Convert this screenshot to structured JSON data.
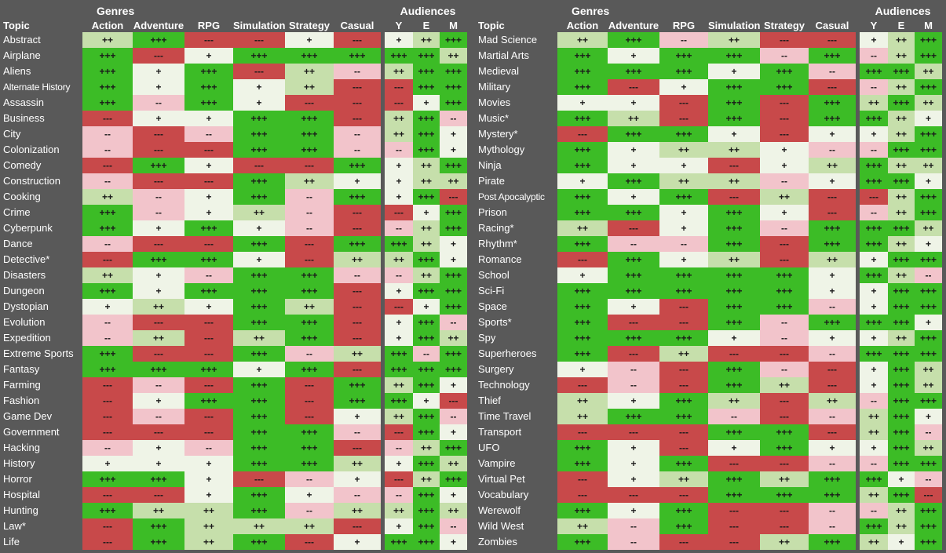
{
  "header": {
    "group_genres": "Genres",
    "group_audiences": "Audiences",
    "topic_label": "Topic",
    "genre_columns": [
      "Action",
      "Adventure",
      "RPG",
      "Simulation",
      "Strategy",
      "Casual"
    ],
    "audience_columns": [
      "Y",
      "E",
      "M"
    ]
  },
  "legend": {
    "values": [
      "+++",
      "++",
      "+",
      "--",
      "---"
    ],
    "colors": {
      "+++": "#3cbc26",
      "++": "#c6dfab",
      "+": "#eff4e7",
      "--": "#f2c4cb",
      "---": "#c8494a",
      "background": "#595959",
      "text": "#ffffff"
    }
  },
  "chart_data": {
    "type": "heatmap",
    "title": "",
    "xlabel": "",
    "ylabel": "Topic",
    "columns": [
      "Action",
      "Adventure",
      "RPG",
      "Simulation",
      "Strategy",
      "Casual",
      "Y",
      "E",
      "M"
    ],
    "column_groups": [
      {
        "name": "Genres",
        "columns": [
          "Action",
          "Adventure",
          "RPG",
          "Simulation",
          "Strategy",
          "Casual"
        ]
      },
      {
        "name": "Audiences",
        "columns": [
          "Y",
          "E",
          "M"
        ]
      }
    ],
    "scale": [
      "---",
      "--",
      "+",
      "++",
      "+++"
    ],
    "left_rows": [
      {
        "topic": "Abstract",
        "values": [
          "++",
          "+++",
          "---",
          "---",
          "+",
          "---",
          "+",
          "++",
          "+++"
        ]
      },
      {
        "topic": "Airplane",
        "values": [
          "+++",
          "---",
          "+",
          "+++",
          "+++",
          "+++",
          "+++",
          "+++",
          "++"
        ]
      },
      {
        "topic": "Aliens",
        "values": [
          "+++",
          "+",
          "+++",
          "---",
          "++",
          "--",
          "++",
          "+++",
          "+++"
        ]
      },
      {
        "topic": "Alternate History",
        "values": [
          "+++",
          "+",
          "+++",
          "+",
          "++",
          "---",
          "---",
          "+++",
          "+++"
        ]
      },
      {
        "topic": "Assassin",
        "values": [
          "+++",
          "--",
          "+++",
          "+",
          "---",
          "---",
          "---",
          "+",
          "+++"
        ]
      },
      {
        "topic": "Business",
        "values": [
          "---",
          "+",
          "+",
          "+++",
          "+++",
          "---",
          "++",
          "+++",
          "--"
        ]
      },
      {
        "topic": "City",
        "values": [
          "--",
          "---",
          "--",
          "+++",
          "+++",
          "--",
          "++",
          "+++",
          "+"
        ]
      },
      {
        "topic": "Colonization",
        "values": [
          "--",
          "---",
          "---",
          "+++",
          "+++",
          "--",
          "--",
          "+++",
          "+"
        ]
      },
      {
        "topic": "Comedy",
        "values": [
          "---",
          "+++",
          "+",
          "---",
          "---",
          "+++",
          "+",
          "++",
          "+++"
        ]
      },
      {
        "topic": "Construction",
        "values": [
          "--",
          "---",
          "---",
          "+++",
          "++",
          "+",
          "+",
          "++",
          "++"
        ]
      },
      {
        "topic": "Cooking",
        "values": [
          "++",
          "--",
          "+",
          "+++",
          "--",
          "+++",
          "+",
          "+++",
          "---"
        ]
      },
      {
        "topic": "Crime",
        "values": [
          "+++",
          "--",
          "+",
          "++",
          "--",
          "---",
          "---",
          "+",
          "+++"
        ]
      },
      {
        "topic": "Cyberpunk",
        "values": [
          "+++",
          "+",
          "+++",
          "+",
          "--",
          "---",
          "--",
          "++",
          "+++"
        ]
      },
      {
        "topic": "Dance",
        "values": [
          "--",
          "---",
          "---",
          "+++",
          "---",
          "+++",
          "+++",
          "++",
          "+"
        ]
      },
      {
        "topic": "Detective*",
        "values": [
          "---",
          "+++",
          "+++",
          "+",
          "---",
          "++",
          "++",
          "+++",
          "+"
        ]
      },
      {
        "topic": "Disasters",
        "values": [
          "++",
          "+",
          "--",
          "+++",
          "+++",
          "--",
          "--",
          "++",
          "+++"
        ]
      },
      {
        "topic": "Dungeon",
        "values": [
          "+++",
          "+",
          "+++",
          "+++",
          "+++",
          "---",
          "+",
          "+++",
          "+++"
        ]
      },
      {
        "topic": "Dystopian",
        "values": [
          "+",
          "++",
          "+",
          "+++",
          "++",
          "---",
          "---",
          "+",
          "+++"
        ]
      },
      {
        "topic": "Evolution",
        "values": [
          "--",
          "---",
          "---",
          "+++",
          "+++",
          "---",
          "+",
          "+++",
          "--"
        ]
      },
      {
        "topic": "Expedition",
        "values": [
          "--",
          "++",
          "---",
          "++",
          "+++",
          "---",
          "+",
          "+++",
          "++"
        ]
      },
      {
        "topic": "Extreme Sports",
        "values": [
          "+++",
          "---",
          "---",
          "+++",
          "--",
          "++",
          "+++",
          "--",
          "+++"
        ]
      },
      {
        "topic": "Fantasy",
        "values": [
          "+++",
          "+++",
          "+++",
          "+",
          "+++",
          "---",
          "+++",
          "+++",
          "+++"
        ]
      },
      {
        "topic": "Farming",
        "values": [
          "---",
          "--",
          "---",
          "+++",
          "---",
          "+++",
          "++",
          "+++",
          "+"
        ]
      },
      {
        "topic": "Fashion",
        "values": [
          "---",
          "+",
          "+++",
          "+++",
          "---",
          "+++",
          "+++",
          "+",
          "---"
        ]
      },
      {
        "topic": "Game Dev",
        "values": [
          "---",
          "--",
          "---",
          "+++",
          "---",
          "+",
          "++",
          "+++",
          "--"
        ]
      },
      {
        "topic": "Government",
        "values": [
          "---",
          "---",
          "---",
          "+++",
          "+++",
          "--",
          "---",
          "+++",
          "+"
        ]
      },
      {
        "topic": "Hacking",
        "values": [
          "--",
          "+",
          "--",
          "+++",
          "+++",
          "---",
          "--",
          "++",
          "+++"
        ]
      },
      {
        "topic": "History",
        "values": [
          "+",
          "+",
          "+",
          "+++",
          "+++",
          "++",
          "+",
          "+++",
          "++"
        ]
      },
      {
        "topic": "Horror",
        "values": [
          "+++",
          "+++",
          "+",
          "---",
          "--",
          "+",
          "---",
          "++",
          "+++"
        ]
      },
      {
        "topic": "Hospital",
        "values": [
          "---",
          "---",
          "+",
          "+++",
          "+",
          "--",
          "--",
          "+++",
          "+"
        ]
      },
      {
        "topic": "Hunting",
        "values": [
          "+++",
          "++",
          "++",
          "+++",
          "--",
          "++",
          "++",
          "+++",
          "++"
        ]
      },
      {
        "topic": "Law*",
        "values": [
          "---",
          "+++",
          "++",
          "++",
          "++",
          "---",
          "+",
          "+++",
          "--"
        ]
      },
      {
        "topic": "Life",
        "values": [
          "---",
          "+++",
          "++",
          "+++",
          "---",
          "+",
          "+++",
          "+++",
          "+"
        ]
      }
    ],
    "right_rows": [
      {
        "topic": "Mad Science",
        "values": [
          "++",
          "+++",
          "--",
          "++",
          "---",
          "---",
          "+",
          "++",
          "+++"
        ]
      },
      {
        "topic": "Martial Arts",
        "values": [
          "+++",
          "+",
          "+++",
          "+++",
          "--",
          "+++",
          "--",
          "++",
          "+++"
        ]
      },
      {
        "topic": "Medieval",
        "values": [
          "+++",
          "+++",
          "+++",
          "+",
          "+++",
          "--",
          "+++",
          "+++",
          "++"
        ]
      },
      {
        "topic": "Military",
        "values": [
          "+++",
          "---",
          "+",
          "+++",
          "+++",
          "---",
          "--",
          "++",
          "+++"
        ]
      },
      {
        "topic": "Movies",
        "values": [
          "+",
          "+",
          "---",
          "+++",
          "---",
          "+++",
          "++",
          "+++",
          "++"
        ]
      },
      {
        "topic": "Music*",
        "values": [
          "+++",
          "++",
          "---",
          "+++",
          "---",
          "+++",
          "+++",
          "++",
          "+"
        ]
      },
      {
        "topic": "Mystery*",
        "values": [
          "---",
          "+++",
          "+++",
          "+",
          "---",
          "+",
          "+",
          "++",
          "+++"
        ]
      },
      {
        "topic": "Mythology",
        "values": [
          "+++",
          "+",
          "++",
          "++",
          "+",
          "--",
          "--",
          "+++",
          "+++"
        ]
      },
      {
        "topic": "Ninja",
        "values": [
          "+++",
          "+",
          "+",
          "---",
          "+",
          "++",
          "+++",
          "++",
          "++"
        ]
      },
      {
        "topic": "Pirate",
        "values": [
          "+",
          "+++",
          "++",
          "++",
          "--",
          "+",
          "+++",
          "+++",
          "+"
        ]
      },
      {
        "topic": "Post Apocalyptic",
        "values": [
          "+++",
          "+",
          "+++",
          "---",
          "++",
          "---",
          "---",
          "++",
          "+++"
        ]
      },
      {
        "topic": "Prison",
        "values": [
          "+++",
          "+++",
          "+",
          "+++",
          "+",
          "---",
          "--",
          "++",
          "+++"
        ]
      },
      {
        "topic": "Racing*",
        "values": [
          "++",
          "---",
          "+",
          "+++",
          "--",
          "+++",
          "+++",
          "+++",
          "++"
        ]
      },
      {
        "topic": "Rhythm*",
        "values": [
          "+++",
          "--",
          "--",
          "+++",
          "---",
          "+++",
          "+++",
          "++",
          "+"
        ]
      },
      {
        "topic": "Romance",
        "values": [
          "---",
          "+++",
          "+",
          "++",
          "---",
          "++",
          "+",
          "+++",
          "+++"
        ]
      },
      {
        "topic": "School",
        "values": [
          "+",
          "+++",
          "+++",
          "+++",
          "+++",
          "+",
          "+++",
          "++",
          "--"
        ]
      },
      {
        "topic": "Sci-Fi",
        "values": [
          "+++",
          "+++",
          "+++",
          "+++",
          "+++",
          "+",
          "+",
          "+++",
          "+++"
        ]
      },
      {
        "topic": "Space",
        "values": [
          "+++",
          "+",
          "---",
          "+++",
          "+++",
          "--",
          "+",
          "+++",
          "+++"
        ]
      },
      {
        "topic": "Sports*",
        "values": [
          "+++",
          "---",
          "---",
          "+++",
          "--",
          "+++",
          "+++",
          "+++",
          "+"
        ]
      },
      {
        "topic": "Spy",
        "values": [
          "+++",
          "+++",
          "+++",
          "+",
          "--",
          "+",
          "+",
          "++",
          "+++"
        ]
      },
      {
        "topic": "Superheroes",
        "values": [
          "+++",
          "---",
          "++",
          "---",
          "---",
          "--",
          "+++",
          "+++",
          "+++"
        ]
      },
      {
        "topic": "Surgery",
        "values": [
          "+",
          "--",
          "---",
          "+++",
          "--",
          "---",
          "+",
          "+++",
          "++"
        ]
      },
      {
        "topic": "Technology",
        "values": [
          "---",
          "--",
          "---",
          "+++",
          "++",
          "---",
          "+",
          "+++",
          "++"
        ]
      },
      {
        "topic": "Thief",
        "values": [
          "++",
          "+",
          "+++",
          "++",
          "---",
          "++",
          "--",
          "+++",
          "+++"
        ]
      },
      {
        "topic": "Time Travel",
        "values": [
          "++",
          "+++",
          "+++",
          "--",
          "---",
          "--",
          "++",
          "+++",
          "+"
        ]
      },
      {
        "topic": "Transport",
        "values": [
          "---",
          "---",
          "---",
          "+++",
          "+++",
          "---",
          "++",
          "+++",
          "--"
        ]
      },
      {
        "topic": "UFO",
        "values": [
          "+++",
          "+",
          "---",
          "+",
          "+++",
          "+",
          "+",
          "+++",
          "++"
        ]
      },
      {
        "topic": "Vampire",
        "values": [
          "+++",
          "+",
          "+++",
          "---",
          "---",
          "--",
          "--",
          "+++",
          "+++"
        ]
      },
      {
        "topic": "Virtual Pet",
        "values": [
          "---",
          "+",
          "++",
          "+++",
          "++",
          "+++",
          "+++",
          "+",
          "--"
        ]
      },
      {
        "topic": "Vocabulary",
        "values": [
          "---",
          "---",
          "---",
          "+++",
          "+++",
          "+++",
          "++",
          "+++",
          "---"
        ]
      },
      {
        "topic": "Werewolf",
        "values": [
          "+++",
          "+",
          "+++",
          "---",
          "---",
          "--",
          "--",
          "++",
          "+++"
        ]
      },
      {
        "topic": "Wild West",
        "values": [
          "++",
          "--",
          "+++",
          "---",
          "---",
          "--",
          "+++",
          "++",
          "+++"
        ]
      },
      {
        "topic": "Zombies",
        "values": [
          "+++",
          "--",
          "---",
          "---",
          "++",
          "+++",
          "++",
          "+",
          "+++"
        ]
      }
    ]
  }
}
